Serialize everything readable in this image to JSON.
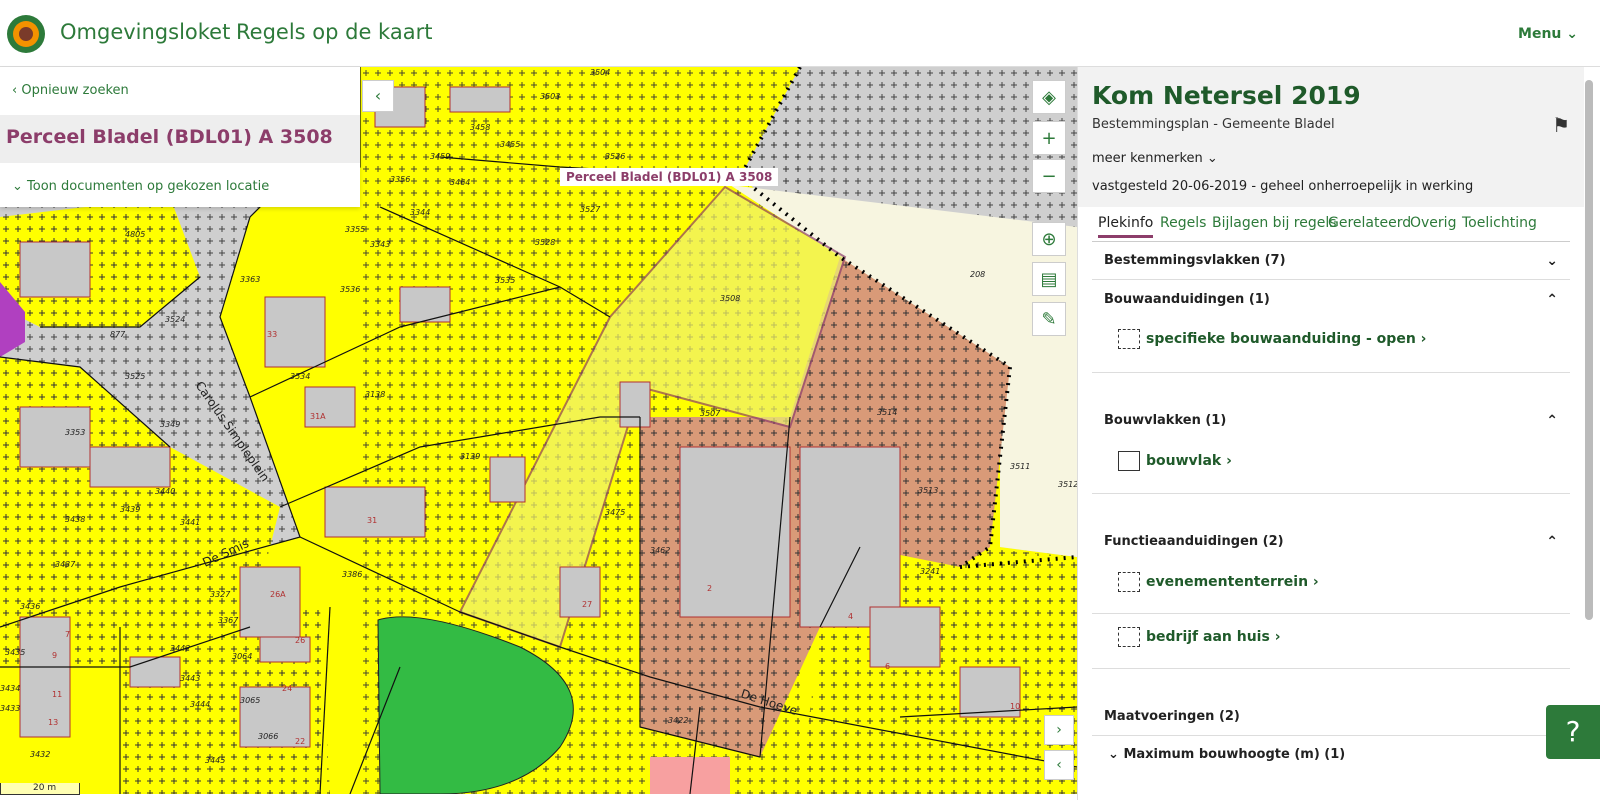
{
  "header": {
    "brand": "Omgevingsloket",
    "app_title": "Regels op de kaart",
    "menu_label": "Menu"
  },
  "search_panel": {
    "back_label": "Opnieuw zoeken",
    "parcel_title": "Perceel Bladel (BDL01) A 3508",
    "docs_label": "Toon documenten op gekozen locatie"
  },
  "map": {
    "selected_label": "Perceel Bladel (BDL01) A 3508",
    "scale_label": "20 m",
    "street_labels": [
      "Carolus Simpleplein",
      "De Smis",
      "De Hoeve"
    ],
    "parcel_numbers": [
      "3504",
      "3503",
      "3458",
      "3455",
      "3526",
      "3459",
      "3464",
      "3356",
      "3344",
      "3527",
      "3355",
      "3343",
      "3528",
      "3363",
      "3536",
      "3535",
      "3508",
      "3524",
      "3534",
      "3525",
      "3138",
      "3507",
      "3514",
      "3353",
      "3349",
      "3511",
      "3139",
      "3513",
      "3512",
      "3440",
      "3439",
      "3438",
      "3441",
      "3475",
      "3462",
      "3437",
      "3327",
      "3241",
      "3436",
      "3386",
      "3367",
      "3442",
      "3064",
      "3435",
      "3443",
      "3065",
      "3434",
      "3433",
      "3444",
      "3066",
      "3422",
      "3432",
      "3445",
      "4805",
      "877",
      "208"
    ],
    "house_numbers": [
      "31A",
      "33",
      "31",
      "26A",
      "26",
      "24",
      "22",
      "27",
      "2",
      "4",
      "6",
      "10",
      "7",
      "9",
      "11",
      "13"
    ]
  },
  "side_panel": {
    "plan_title": "Kom Netersel 2019",
    "plan_subtitle": "Bestemmingsplan - Gemeente Bladel",
    "meer_label": "meer kenmerken",
    "status": "vastgesteld 20-06-2019 - geheel onherroepelijk in werking",
    "tabs": [
      {
        "label": "Plekinfo"
      },
      {
        "label": "Regels"
      },
      {
        "label": "Bijlagen bij regels"
      },
      {
        "label": "Gerelateerd"
      },
      {
        "label": "Overig"
      },
      {
        "label": "Toelichting"
      }
    ],
    "sections": {
      "bestemmingsvlakken": "Bestemmingsvlakken (7)",
      "bouwaanduidingen": "Bouwaanduidingen (1)",
      "bouwaanduiding_item": "specifieke bouwaanduiding - open",
      "bouwvlakken": "Bouwvlakken (1)",
      "bouwvlak_item": "bouwvlak",
      "functieaanduidingen": "Functieaanduidingen (2)",
      "functie_item_1": "evenemententerrein",
      "functie_item_2": "bedrijf aan huis",
      "maatvoeringen": "Maatvoeringen (2)",
      "max_bouwhoogte": "Maximum bouwhoogte (m) (1)"
    }
  },
  "colors": {
    "brand_green": "#2d7a3a",
    "parcel_purple": "#8c3d6a",
    "map_yellow": "#ffff00",
    "map_brown": "#d99a78",
    "map_green": "#33bb44"
  }
}
